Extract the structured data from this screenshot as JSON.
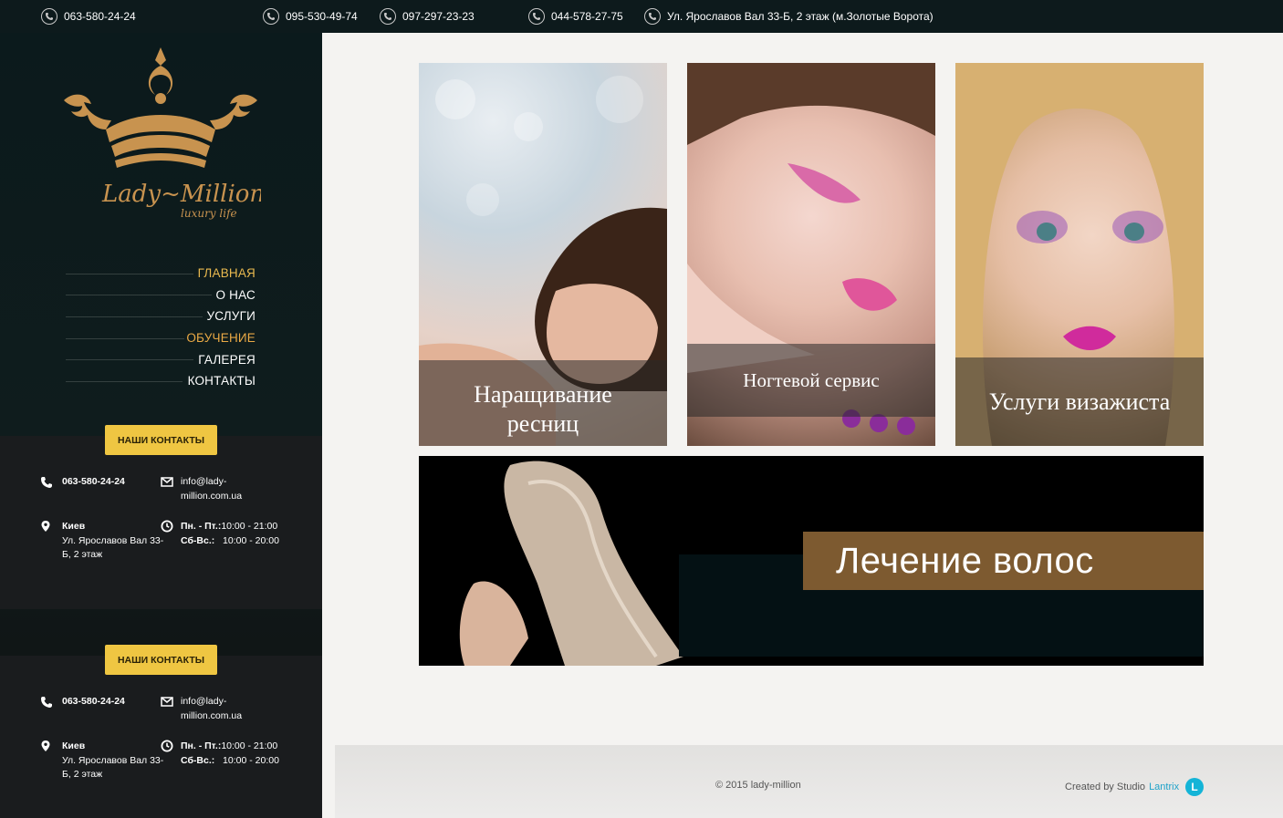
{
  "topbar": {
    "phones": [
      "063-580-24-24",
      "095-530-49-74",
      "097-297-23-23",
      "044-578-27-75"
    ],
    "address": "Ул. Ярославов Вал 33-Б, 2 этаж (м.Золотые Ворота)"
  },
  "logo": {
    "text": "Lady~Million",
    "tagline": "luxury life"
  },
  "nav": {
    "items": [
      {
        "label": "ГЛАВНАЯ"
      },
      {
        "label": "О НАС"
      },
      {
        "label": "УСЛУГИ"
      },
      {
        "label": "ОБУЧЕНИЕ"
      },
      {
        "label": "ГАЛЕРЕЯ"
      },
      {
        "label": "КОНТАКТЫ"
      }
    ]
  },
  "contacts": {
    "button_label": "НАШИ КОНТАКТЫ",
    "phone": "063-580-24-24",
    "email_line1": "info@lady-",
    "email_line2": "million.com.ua",
    "city": "Киев",
    "address_line1": "Ул. Ярославов Вал 33-",
    "address_line2": "Б, 2 этаж",
    "weekday_label": "Пн. - Пт.:",
    "weekday_hours": "10:00 - 21:00",
    "weekend_label": "Сб-Вс.:",
    "weekend_hours": "10:00 - 20:00"
  },
  "services": {
    "lashes_line1": "Наращивание",
    "lashes_line2": "ресниц",
    "nails": "Ногтевой сервис",
    "makeup": "Услуги визажиста",
    "hair": "Лечение волос"
  },
  "footer": {
    "copyright": "© 2015 lady-million",
    "created_by": "Created by Studio",
    "studio": "Lantrix",
    "studio_badge": "L"
  },
  "colors": {
    "accent_gold": "#efc642",
    "active_nav": "#e9b94f",
    "banner_brown": "#7d5a30",
    "studio_blue": "#14b4d7"
  }
}
